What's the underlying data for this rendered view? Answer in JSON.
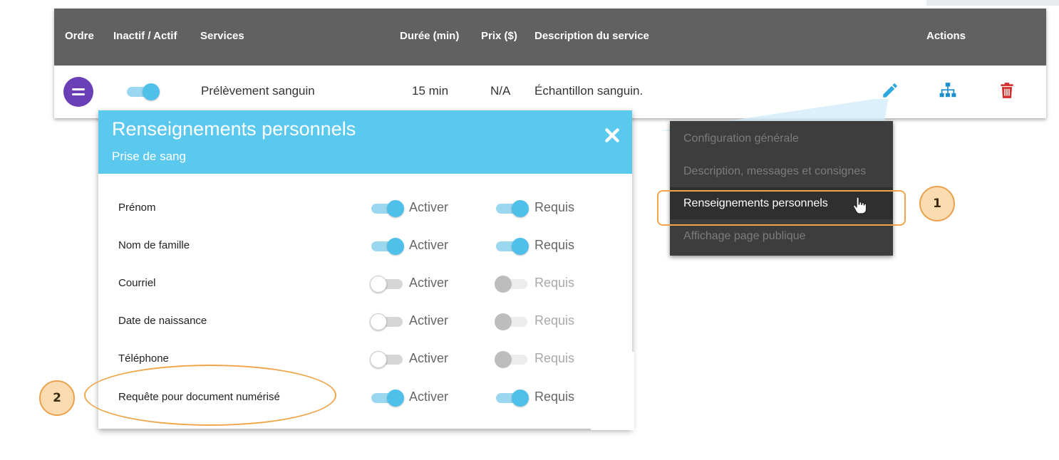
{
  "table": {
    "headers": {
      "order": "Ordre",
      "active": "Inactif / Actif",
      "services": "Services",
      "duration": "Durée (min)",
      "price": "Prix ($)",
      "description": "Description du service",
      "actions": "Actions"
    },
    "row": {
      "service": "Prélèvement sanguin",
      "duration": "15 min",
      "price": "N/A",
      "description": "Échantillon sanguin.",
      "active": true
    }
  },
  "dialog": {
    "title": "Renseignements personnels",
    "subtitle": "Prise de sang",
    "enable_label": "Activer",
    "required_label": "Requis",
    "fields": [
      {
        "label": "Prénom",
        "enabled": true,
        "required": true
      },
      {
        "label": "Nom de famille",
        "enabled": true,
        "required": true
      },
      {
        "label": "Courriel",
        "enabled": false,
        "required": false
      },
      {
        "label": "Date de naissance",
        "enabled": false,
        "required": false
      },
      {
        "label": "Téléphone",
        "enabled": false,
        "required": false
      },
      {
        "label": "Requête pour document numérisé",
        "enabled": true,
        "required": true
      }
    ]
  },
  "menu": {
    "items": [
      "Configuration générale",
      "Description, messages et consignes",
      "Renseignements personnels",
      "Affichage page publique"
    ],
    "active_index": 2
  },
  "annotations": {
    "badge_1": "1",
    "badge_2": "2"
  },
  "colors": {
    "header_bg": "#616161",
    "dialog_header": "#5bc8ee",
    "toggle_on": "#4fc0ea",
    "order_button": "#6a3fb5",
    "edit_icon": "#2fa8e0",
    "tree_icon": "#1a8fd0",
    "delete_icon": "#d32f2f",
    "menu_bg": "#3d3d3d",
    "annotation": "#f0a54a"
  },
  "icons": {
    "order": "drag-handle-icon",
    "edit": "pencil-icon",
    "structure": "sitemap-icon",
    "delete": "trash-icon",
    "close": "close-icon",
    "cursor": "hand-pointer-icon"
  }
}
